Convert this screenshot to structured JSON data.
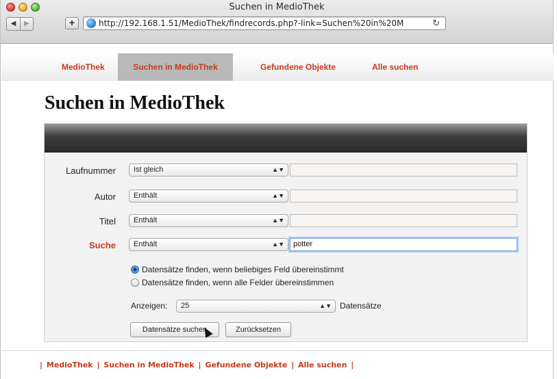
{
  "window": {
    "title": "Suchen in MedioThek"
  },
  "browser": {
    "back_icon": "◀",
    "forward_icon": "▶",
    "add_icon": "+",
    "url": "http://192.168.1.51/MedioThek/findrecords.php?-link=Suchen%20in%20M",
    "reload_icon": "↻"
  },
  "nav": {
    "items": [
      {
        "label": "MedioThek"
      },
      {
        "label": "Suchen in MedioThek",
        "active": true
      },
      {
        "label": "Gefundene Objekte"
      },
      {
        "label": "Alle suchen"
      }
    ]
  },
  "page": {
    "title": "Suchen in MedioThek"
  },
  "form": {
    "rows": [
      {
        "label": "Laufnummer",
        "operator": "Ist gleich",
        "value": ""
      },
      {
        "label": "Autor",
        "operator": "Enthält",
        "value": ""
      },
      {
        "label": "Titel",
        "operator": "Enthält",
        "value": ""
      },
      {
        "label": "Suche",
        "operator": "Enthält",
        "value": "potter"
      }
    ],
    "radio_any": "Datensätze finden, wenn beliebiges Feld übereinstimmt",
    "radio_all": "Datensätze finden, wenn alle Felder übereinstimmen",
    "show_label": "Anzeigen:",
    "show_value": "25",
    "show_suffix": "Datensätze",
    "search_button": "Datensätze suchen",
    "reset_button": "Zurücksetzen"
  },
  "footer": {
    "links": [
      "MedioThek",
      "Suchen in MedioThek",
      "Gefundene Objekte",
      "Alle suchen"
    ],
    "separator": "|"
  },
  "colors": {
    "accent": "#c73a1a",
    "focus": "#7fa9d8"
  }
}
